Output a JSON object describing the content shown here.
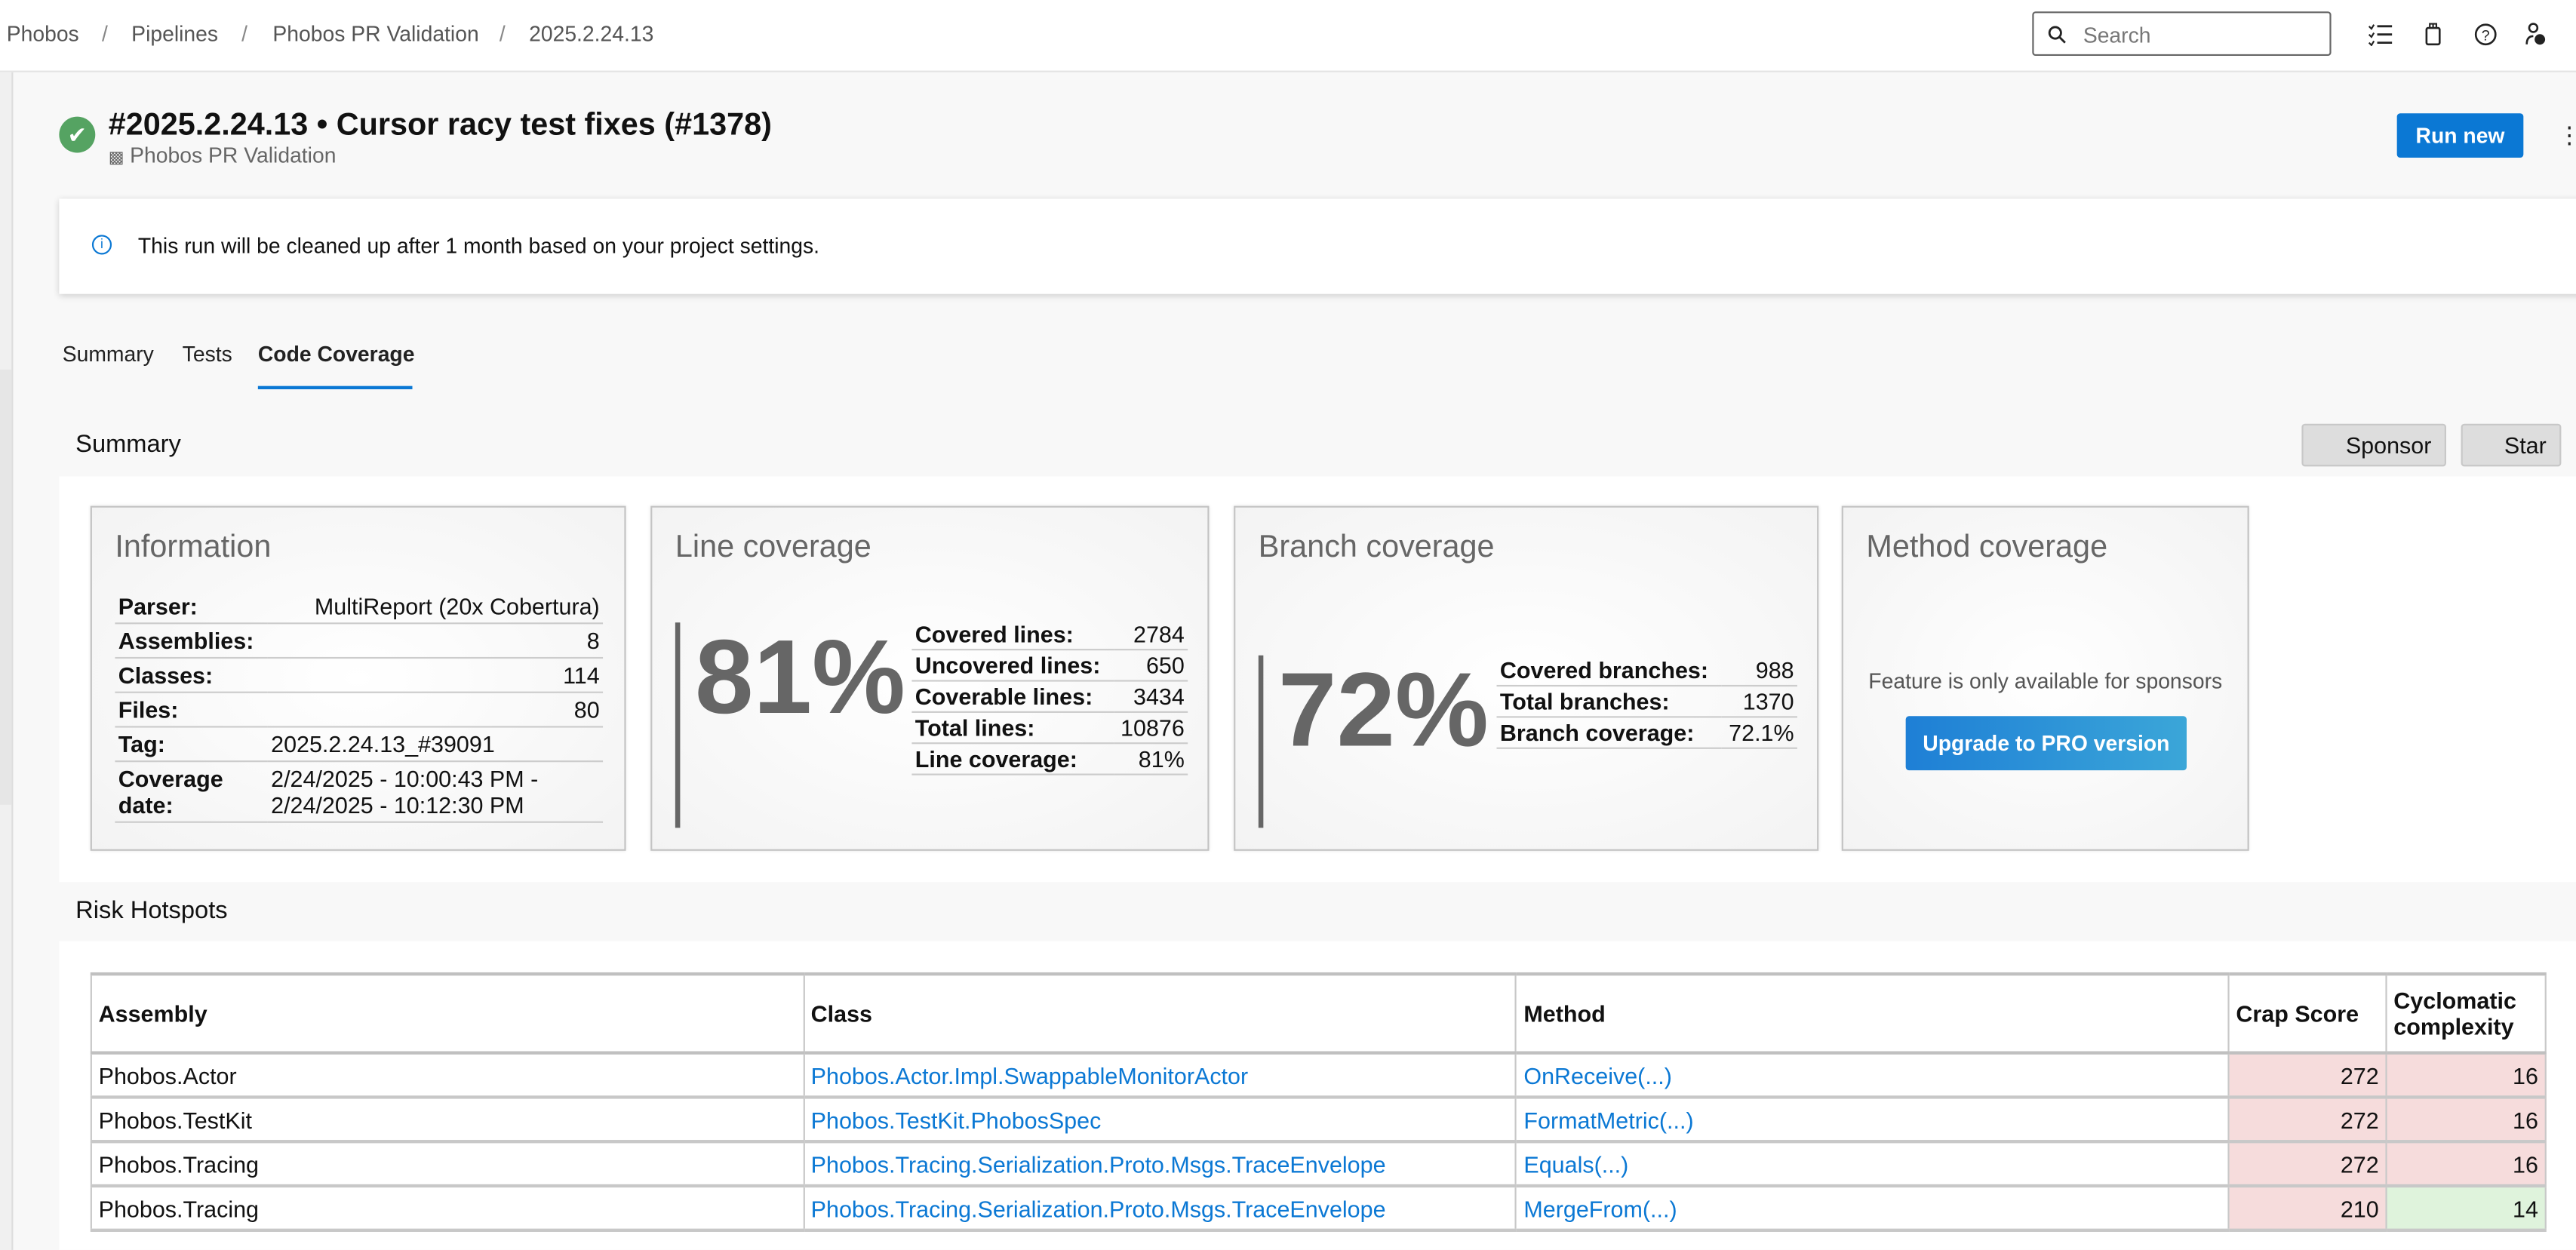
{
  "breadcrumb": [
    "Phobos",
    "Pipelines",
    "Phobos PR Validation",
    "2025.2.24.13"
  ],
  "search": {
    "placeholder": "Search"
  },
  "icons": {
    "search": "search-icon",
    "tasks": "checklist-icon",
    "bag": "shopping-bag-icon",
    "help": "help-icon",
    "user_settings": "user-settings-icon",
    "more": "more-vertical-icon",
    "status": "success-check-icon",
    "info": "info-icon",
    "pipeline": "pipeline-icon"
  },
  "run": {
    "title": "#2025.2.24.13 • Cursor racy test fixes (#1378)",
    "pipeline": "Phobos PR Validation",
    "status": "succeeded",
    "run_new": "Run new"
  },
  "banner": "This run will be cleaned up after 1 month based on your project settings.",
  "tabs": [
    "Summary",
    "Tests",
    "Code Coverage"
  ],
  "active_tab": "Code Coverage",
  "summary": {
    "heading": "Summary",
    "sponsor": "Sponsor",
    "star": "Star",
    "information": {
      "title": "Information",
      "rows": [
        {
          "k": "Parser:",
          "v": "MultiReport (20x Cobertura)"
        },
        {
          "k": "Assemblies:",
          "v": "8"
        },
        {
          "k": "Classes:",
          "v": "114"
        },
        {
          "k": "Files:",
          "v": "80"
        },
        {
          "k": "Tag:",
          "v": "2025.2.24.13_#39091"
        },
        {
          "k": "Coverage date:",
          "v": "2/24/2025 - 10:00:43 PM - 2/24/2025 - 10:12:30 PM"
        }
      ]
    },
    "line": {
      "title": "Line coverage",
      "percent": "81%",
      "rows": [
        {
          "k": "Covered lines:",
          "v": "2784"
        },
        {
          "k": "Uncovered lines:",
          "v": "650"
        },
        {
          "k": "Coverable lines:",
          "v": "3434"
        },
        {
          "k": "Total lines:",
          "v": "10876"
        },
        {
          "k": "Line coverage:",
          "v": "81%"
        }
      ]
    },
    "branch": {
      "title": "Branch coverage",
      "percent": "72%",
      "rows": [
        {
          "k": "Covered branches:",
          "v": "988"
        },
        {
          "k": "Total branches:",
          "v": "1370"
        },
        {
          "k": "Branch coverage:",
          "v": "72.1%"
        }
      ]
    },
    "method": {
      "title": "Method coverage",
      "note": "Feature is only available for sponsors",
      "button": "Upgrade to PRO version"
    }
  },
  "risk": {
    "heading": "Risk Hotspots",
    "columns": [
      "Assembly",
      "Class",
      "Method",
      "Crap Score",
      "Cyclomatic complexity"
    ],
    "rows": [
      {
        "assembly": "Phobos.Actor",
        "class": "Phobos.Actor.Impl.SwappableMonitorActor",
        "method": "OnReceive(...)",
        "crap": "272",
        "cc": "16",
        "crap_status": "bad",
        "cc_status": "bad"
      },
      {
        "assembly": "Phobos.TestKit",
        "class": "Phobos.TestKit.PhobosSpec",
        "method": "FormatMetric(...)",
        "crap": "272",
        "cc": "16",
        "crap_status": "bad",
        "cc_status": "bad"
      },
      {
        "assembly": "Phobos.Tracing",
        "class": "Phobos.Tracing.Serialization.Proto.Msgs.TraceEnvelope",
        "method": "Equals(...)",
        "crap": "272",
        "cc": "16",
        "crap_status": "bad",
        "cc_status": "bad"
      },
      {
        "assembly": "Phobos.Tracing",
        "class": "Phobos.Tracing.Serialization.Proto.Msgs.TraceEnvelope",
        "method": "MergeFrom(...)",
        "crap": "210",
        "cc": "14",
        "crap_status": "bad",
        "cc_status": "good"
      }
    ]
  },
  "colors": {
    "accent": "#0b78d4",
    "success": "#55a362",
    "risk_bad": "#f6dcdc",
    "risk_good": "#dff3dc"
  }
}
